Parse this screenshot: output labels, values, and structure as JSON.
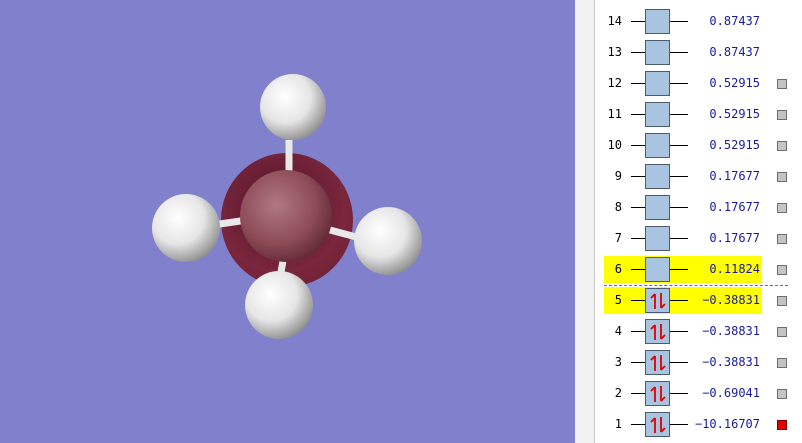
{
  "viewport": {
    "background": "#8080cc",
    "molecule": {
      "central_atom_color": "#8c4b57",
      "surface_color": "#6e1a2a",
      "hydrogen_color": "#f0f0f0",
      "hydrogen_count": 4
    }
  },
  "orbitals": [
    {
      "index": "14",
      "energy": "0.87437",
      "occupied": false,
      "highlighted": false,
      "marker": "none"
    },
    {
      "index": "13",
      "energy": "0.87437",
      "occupied": false,
      "highlighted": false,
      "marker": "none"
    },
    {
      "index": "12",
      "energy": "0.52915",
      "occupied": false,
      "highlighted": false,
      "marker": "gray"
    },
    {
      "index": "11",
      "energy": "0.52915",
      "occupied": false,
      "highlighted": false,
      "marker": "gray"
    },
    {
      "index": "10",
      "energy": "0.52915",
      "occupied": false,
      "highlighted": false,
      "marker": "gray"
    },
    {
      "index": "9",
      "energy": "0.17677",
      "occupied": false,
      "highlighted": false,
      "marker": "gray"
    },
    {
      "index": "8",
      "energy": "0.17677",
      "occupied": false,
      "highlighted": false,
      "marker": "gray"
    },
    {
      "index": "7",
      "energy": "0.17677",
      "occupied": false,
      "highlighted": false,
      "marker": "gray"
    },
    {
      "index": "6",
      "energy": "0.11824",
      "occupied": false,
      "highlighted": true,
      "marker": "gray"
    },
    {
      "index": "5",
      "energy": "−0.38831",
      "occupied": true,
      "highlighted": true,
      "marker": "gray"
    },
    {
      "index": "4",
      "energy": "−0.38831",
      "occupied": true,
      "highlighted": false,
      "marker": "gray"
    },
    {
      "index": "3",
      "energy": "−0.38831",
      "occupied": true,
      "highlighted": false,
      "marker": "gray"
    },
    {
      "index": "2",
      "energy": "−0.69041",
      "occupied": true,
      "highlighted": false,
      "marker": "gray"
    },
    {
      "index": "1",
      "energy": "−10.16707",
      "occupied": true,
      "highlighted": false,
      "marker": "red"
    }
  ],
  "colors": {
    "orbital_box": "#a8c4e0",
    "energy_text": "#1a1aa0",
    "highlight": "#ffff00",
    "electron_arrows": "#e00000",
    "homo_lumo_divider": "#2a9a2a"
  }
}
